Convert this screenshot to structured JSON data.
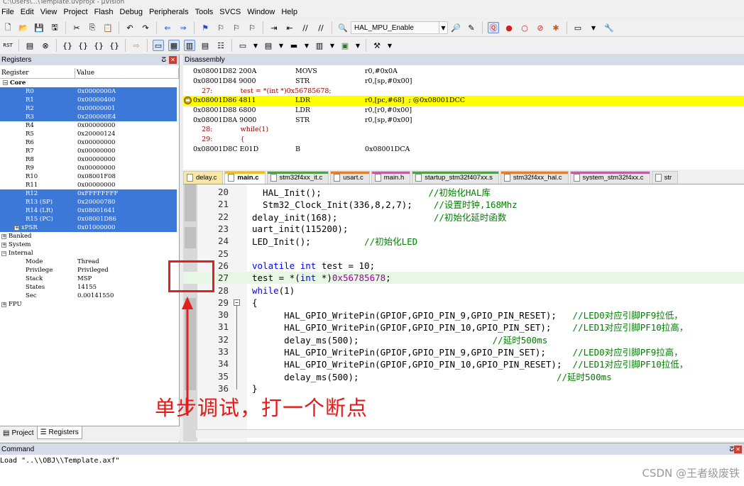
{
  "window": {
    "title": "C:\\Users\\...\\Template.uvprojx - µVision"
  },
  "menu": [
    "File",
    "Edit",
    "View",
    "Project",
    "Flash",
    "Debug",
    "Peripherals",
    "Tools",
    "SVCS",
    "Window",
    "Help"
  ],
  "toolbar": {
    "target_combo": "HAL_MPU_Enable"
  },
  "registers": {
    "panel_title": "Registers",
    "col_register": "Register",
    "col_value": "Value",
    "rows": [
      {
        "name": "Core",
        "value": "",
        "group": true
      },
      {
        "name": "R0",
        "value": "0x0000000A",
        "sel": true
      },
      {
        "name": "R1",
        "value": "0x00000400",
        "sel": true
      },
      {
        "name": "R2",
        "value": "0x00000001",
        "sel": true
      },
      {
        "name": "R3",
        "value": "0x200000E4",
        "sel": true
      },
      {
        "name": "R4",
        "value": "0x00000000"
      },
      {
        "name": "R5",
        "value": "0x20000124"
      },
      {
        "name": "R6",
        "value": "0x00000000"
      },
      {
        "name": "R7",
        "value": "0x00000000"
      },
      {
        "name": "R8",
        "value": "0x00000000"
      },
      {
        "name": "R9",
        "value": "0x00000000"
      },
      {
        "name": "R10",
        "value": "0x08001F08"
      },
      {
        "name": "R11",
        "value": "0x00000000"
      },
      {
        "name": "R12",
        "value": "0xFFFFFFFF",
        "sel": true
      },
      {
        "name": "R13 (SP)",
        "value": "0x20000780",
        "sel": true
      },
      {
        "name": "R14 (LR)",
        "value": "0x08001641",
        "sel": true
      },
      {
        "name": "R15 (PC)",
        "value": "0x08001D86",
        "sel": true
      },
      {
        "name": "xPSR",
        "value": "0x01000000",
        "sel": true,
        "exp": true
      },
      {
        "name": "Banked",
        "value": "",
        "exp": true,
        "top": true
      },
      {
        "name": "System",
        "value": "",
        "exp": true,
        "top": true
      },
      {
        "name": "Internal",
        "value": "",
        "exp": true,
        "top": true,
        "open": true
      },
      {
        "name": "Mode",
        "value": "Thread"
      },
      {
        "name": "Privilege",
        "value": "Privileged"
      },
      {
        "name": "Stack",
        "value": "MSP"
      },
      {
        "name": "States",
        "value": "14155"
      },
      {
        "name": "Sec",
        "value": "0.00141550"
      },
      {
        "name": "FPU",
        "value": "",
        "exp": true,
        "top": true
      }
    ],
    "tabs": [
      "Project",
      "Registers"
    ]
  },
  "disassembly": {
    "panel_title": "Disassembly",
    "rows": [
      {
        "addr": "0x08001D82 200A",
        "op": "MOVS",
        "arg": "r0,#0x0A"
      },
      {
        "addr": "0x08001D84 9000",
        "op": "STR",
        "arg": "r0,[sp,#0x00]"
      },
      {
        "src": "    27:             test = *(int *)0x56785678;"
      },
      {
        "addr": "0x08001D86 4811",
        "op": "LDR",
        "arg": "r0,[pc,#68]  ; @0x08001DCC",
        "cur": true
      },
      {
        "addr": "0x08001D88 6800",
        "op": "LDR",
        "arg": "r0,[r0,#0x00]"
      },
      {
        "addr": "0x08001D8A 9000",
        "op": "STR",
        "arg": "r0,[sp,#0x00]"
      },
      {
        "src": "    28:             while(1)"
      },
      {
        "src": "    29:             {"
      },
      {
        "addr": "0x08001D8C E01D",
        "op": "B",
        "arg": "0x08001DCA"
      }
    ]
  },
  "editor": {
    "tabs": [
      {
        "label": "delay.c",
        "cls": "yellow"
      },
      {
        "label": "main.c",
        "cls": "active"
      },
      {
        "label": "stm32f4xx_it.c",
        "cls": "green"
      },
      {
        "label": "usart.c",
        "cls": "orange"
      },
      {
        "label": "main.h",
        "cls": "pink"
      },
      {
        "label": "startup_stm32f407xx.s",
        "cls": "green"
      },
      {
        "label": "stm32f4xx_hal.c",
        "cls": "orange"
      },
      {
        "label": "system_stm32f4xx.c",
        "cls": "pink"
      },
      {
        "label": "str",
        "cls": ""
      }
    ],
    "lines": [
      {
        "n": "20",
        "code": "  HAL_Init();",
        "cm": "                    //初始化HAL库"
      },
      {
        "n": "21",
        "code": "  Stm32_Clock_Init(336,8,2,7);",
        "cm": "    //设置时钟,168Mhz"
      },
      {
        "n": "22",
        "code": "delay_init(168);",
        "cm": "                  //初始化延时函数"
      },
      {
        "n": "23",
        "code": "uart_init(115200);",
        "cm": ""
      },
      {
        "n": "24",
        "code": "LED_Init();",
        "cm": "          //初始化LED"
      },
      {
        "n": "25",
        "code": "",
        "cm": ""
      },
      {
        "n": "26",
        "kw": "volatile int",
        "code": " test = 10;",
        "cm": ""
      },
      {
        "n": "27",
        "code": "test = *(",
        "kw2": "int",
        "code2": " *)",
        "num": "0x56785678",
        "code3": ";",
        "hl": true
      },
      {
        "n": "28",
        "kw": "while",
        "code": "(1)",
        "cm": ""
      },
      {
        "n": "29",
        "code": "{",
        "cm": "",
        "fold": true
      },
      {
        "n": "30",
        "code": "      HAL_GPIO_WritePin(GPIOF,GPIO_PIN_9,GPIO_PIN_RESET);",
        "cm": "   //LED0对应引脚PF9拉低，"
      },
      {
        "n": "31",
        "code": "      HAL_GPIO_WritePin(GPIOF,GPIO_PIN_10,GPIO_PIN_SET);",
        "cm": "    //LED1对应引脚PF10拉高，"
      },
      {
        "n": "32",
        "code": "      delay_ms(500);",
        "cm": "                         //延时500ms"
      },
      {
        "n": "33",
        "code": "      HAL_GPIO_WritePin(GPIOF,GPIO_PIN_9,GPIO_PIN_SET);",
        "cm": "     //LED0对应引脚PF9拉高，"
      },
      {
        "n": "34",
        "code": "      HAL_GPIO_WritePin(GPIOF,GPIO_PIN_10,GPIO_PIN_RESET);",
        "cm": "  //LED1对应引脚PF10拉低，"
      },
      {
        "n": "35",
        "code": "      delay_ms(500);",
        "cm": "                                     //延时500ms"
      },
      {
        "n": "36",
        "code": "}",
        "cm": ""
      }
    ]
  },
  "annotation": {
    "text": "单步调试，打一个断点"
  },
  "command": {
    "panel_title": "Command",
    "text": "Load \"..\\\\OBJ\\\\Template.axf\""
  },
  "watermark": "CSDN @王者级废铁",
  "colors": {
    "selection": "#3c78d8",
    "current_line": "#ffff00",
    "annotation": "#e81818",
    "comment": "#008000",
    "keyword": "#0000ff"
  }
}
